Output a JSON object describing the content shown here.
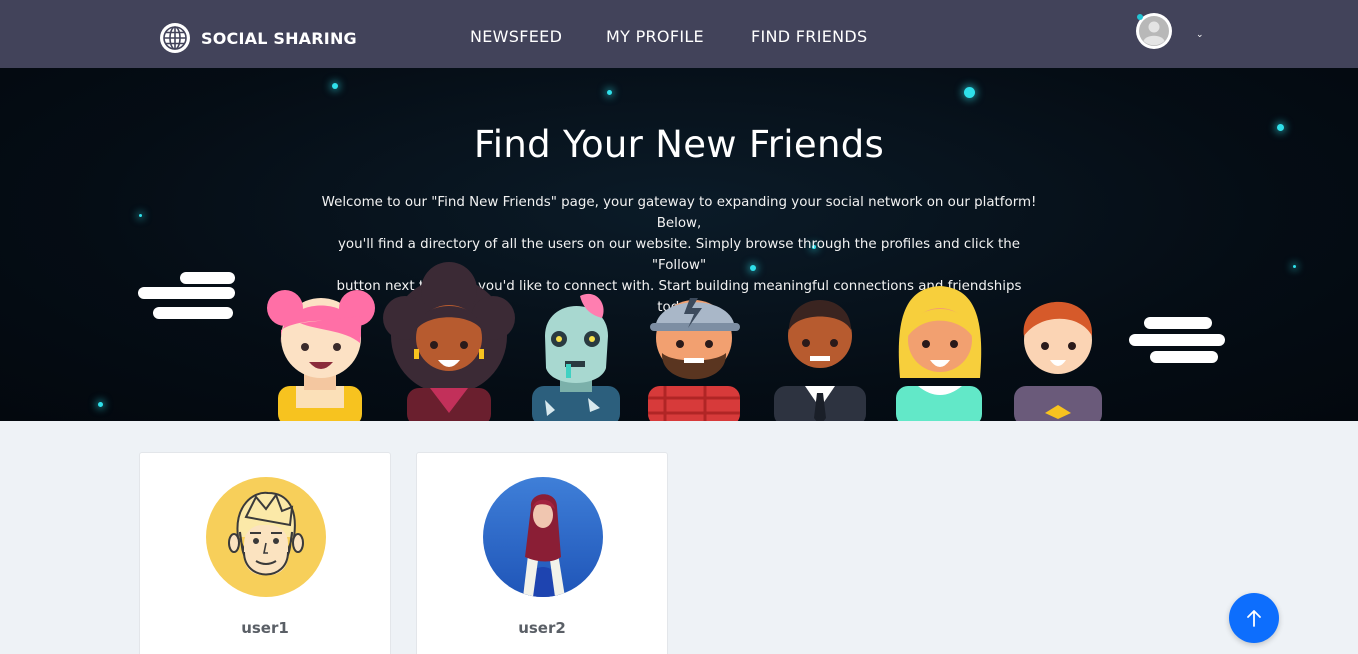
{
  "navbar": {
    "brand": "SOCIAL SHARING",
    "links": [
      "NEWSFEED",
      "MY PROFILE",
      "FIND FRIENDS"
    ]
  },
  "hero": {
    "title": "Find Your New Friends",
    "description_lines": [
      "Welcome to our \"Find New Friends\" page, your gateway to expanding your social network on our platform! Below,",
      "you'll find a directory of all the users on our website. Simply browse through the profiles and click the \"Follow\"",
      "button next to those you'd like to connect with. Start building meaningful connections and friendships today!"
    ]
  },
  "users": [
    {
      "username": "user1"
    },
    {
      "username": "user2"
    }
  ],
  "icons": {
    "brand": "globe-icon",
    "account": "user-avatar-icon",
    "menu": "chevron-down-icon",
    "scroll": "arrow-up-icon"
  },
  "colors": {
    "navbar": "#42435a",
    "hero_bg": "#050d15",
    "star": "#2fe0ea",
    "page_bg": "#eef2f6",
    "accent": "#0d6efd",
    "online": "#23c4d4"
  }
}
